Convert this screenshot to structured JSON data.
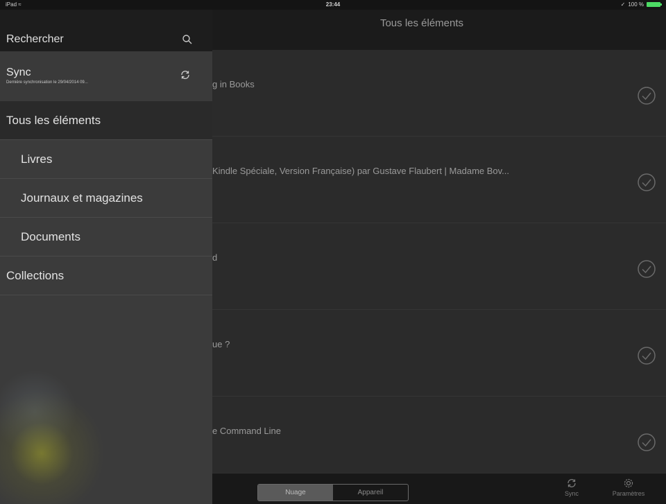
{
  "status": {
    "device": "iPad",
    "time": "23:44",
    "battery": "100 %",
    "colors": {
      "battery": "#4cd964"
    }
  },
  "header": {
    "title": "Tous les éléments"
  },
  "sidebar": {
    "search": {
      "label": "Rechercher",
      "icon": "search-icon"
    },
    "sync": {
      "title": "Sync",
      "subtitle": "Dernière synchronisation le 29/04/2014 09...",
      "icon": "sync-icon"
    },
    "items": [
      {
        "label": "Tous les éléments"
      },
      {
        "label": "Livres"
      },
      {
        "label": "Journaux et magazines"
      },
      {
        "label": "Documents"
      },
      {
        "label": "Collections"
      }
    ]
  },
  "list": {
    "items": [
      {
        "title": "g in Books"
      },
      {
        "title": "Kindle Spéciale, Version Française) par Gustave Flaubert | Madame Bov..."
      },
      {
        "title": "d"
      },
      {
        "title": "ue ?"
      },
      {
        "title": "e Command Line"
      }
    ]
  },
  "bottom_bar": {
    "segments": [
      "Nuage",
      "Appareil"
    ],
    "sync_label": "Sync",
    "settings_label": "Paramètres"
  }
}
